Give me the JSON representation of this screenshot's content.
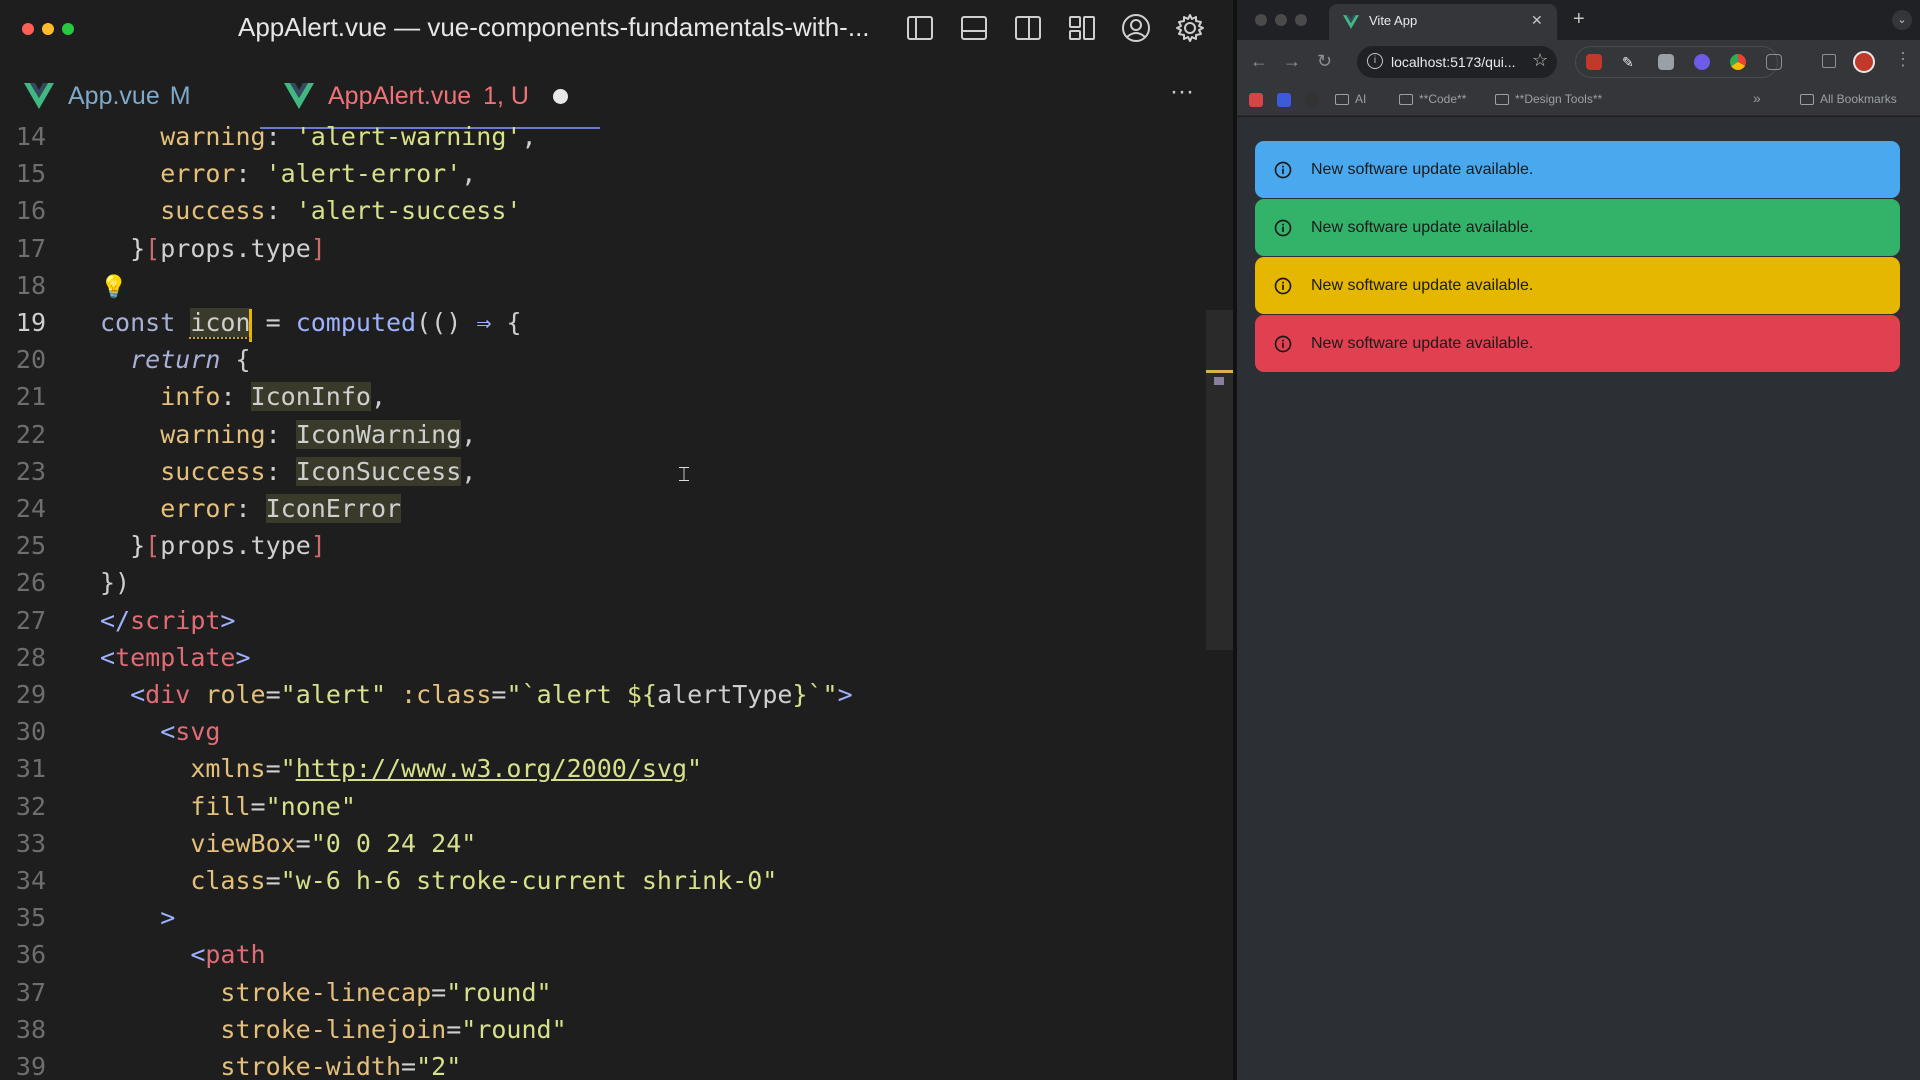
{
  "editor": {
    "title": "AppAlert.vue — vue-components-fundamentals-with-...",
    "tabs": [
      {
        "name": "App.vue",
        "status": "M",
        "active": false
      },
      {
        "name": "AppAlert.vue",
        "status": "1, U",
        "active": true
      }
    ],
    "more_label": "···",
    "lines": [
      {
        "n": "14",
        "html": "    <span class='t-key'>warning</span>: <span class='t-str'>'alert-warning'</span>,"
      },
      {
        "n": "15",
        "html": "    <span class='t-key'>error</span>: <span class='t-str'>'alert-error'</span>,"
      },
      {
        "n": "16",
        "html": "    <span class='t-key'>success</span>: <span class='t-str'>'alert-success'</span>"
      },
      {
        "n": "17",
        "html": "  <span class='t-brace'>}</span><span class='t-br'>[</span>props.type<span class='t-br'>]</span>"
      },
      {
        "n": "18",
        "html": ""
      },
      {
        "n": "19",
        "html": "<span class='t-kw' style='font-style:normal'>const</span> <span class='t-hl'>icon</span> = <span class='t-fn'>computed</span>(() <span class='t-op'>⇒</span> {",
        "current": true
      },
      {
        "n": "20",
        "html": "  <span class='t-kw'>return</span> {"
      },
      {
        "n": "21",
        "html": "    <span class='t-key'>info</span>: <span class='t-hl'>IconInfo</span>,"
      },
      {
        "n": "22",
        "html": "    <span class='t-key'>warning</span>: <span class='t-hl'>IconWarning</span>,"
      },
      {
        "n": "23",
        "html": "    <span class='t-key'>success</span>: <span class='t-hl'>IconSuccess</span>,"
      },
      {
        "n": "24",
        "html": "    <span class='t-key'>error</span>: <span class='t-hl'>IconError</span>"
      },
      {
        "n": "25",
        "html": "  <span class='t-brace'>}</span><span class='t-br'>[</span>props.type<span class='t-br'>]</span>"
      },
      {
        "n": "26",
        "html": "})"
      },
      {
        "n": "27",
        "html": "<span class='t-op'>&lt;/</span><span class='t-tag'>script</span><span class='t-op'>&gt;</span>"
      },
      {
        "n": "28",
        "html": "<span class='t-op'>&lt;</span><span class='t-tag'>template</span><span class='t-op'>&gt;</span>"
      },
      {
        "n": "29",
        "html": "  <span class='t-op'>&lt;</span><span class='t-tag'>div</span> <span class='t-attr'>role</span>=<span class='t-str'>\"alert\"</span> <span class='t-attr'>:class</span>=<span class='t-str'>\"`alert ${</span>alertType<span class='t-str'>}`\"</span><span class='t-op'>&gt;</span>"
      },
      {
        "n": "30",
        "html": "    <span class='t-op'>&lt;</span><span class='t-tag'>svg</span>"
      },
      {
        "n": "31",
        "html": "      <span class='t-attr'>xmlns</span>=<span class='t-str'>\"</span><span class='t-url'>http://www.w3.org/2000/svg</span><span class='t-str'>\"</span>"
      },
      {
        "n": "32",
        "html": "      <span class='t-attr'>fill</span>=<span class='t-str'>\"none\"</span>"
      },
      {
        "n": "33",
        "html": "      <span class='t-attr'>viewBox</span>=<span class='t-str'>\"0 0 24 24\"</span>"
      },
      {
        "n": "34",
        "html": "      <span class='t-attr'>class</span>=<span class='t-str'>\"w-6 h-6 stroke-current shrink-0\"</span>"
      },
      {
        "n": "35",
        "html": "    <span class='t-op'>&gt;</span>"
      },
      {
        "n": "36",
        "html": "      <span class='t-op'>&lt;</span><span class='t-tag'>path</span>"
      },
      {
        "n": "37",
        "html": "        <span class='t-attr'>stroke-linecap</span>=<span class='t-str'>\"round\"</span>"
      },
      {
        "n": "38",
        "html": "        <span class='t-attr'>stroke-linejoin</span>=<span class='t-str'>\"round\"</span>"
      },
      {
        "n": "39",
        "html": "        <span class='t-attr'>stroke-width</span>=<span class='t-str'>\"2\"</span>"
      }
    ]
  },
  "browser": {
    "tab_title": "Vite App",
    "url": "localhost:5173/qui...",
    "bookmarks": {
      "ai": "AI",
      "code": "**Code**",
      "design": "**Design Tools**",
      "all": "All Bookmarks",
      "overflow": "»"
    },
    "alerts": [
      {
        "text": "New software update available.",
        "color": "#4aa8ee"
      },
      {
        "text": "New software update available.",
        "color": "#33b26a"
      },
      {
        "text": "New software update available.",
        "color": "#e6b700"
      },
      {
        "text": "New software update available.",
        "color": "#e0404f"
      }
    ]
  }
}
